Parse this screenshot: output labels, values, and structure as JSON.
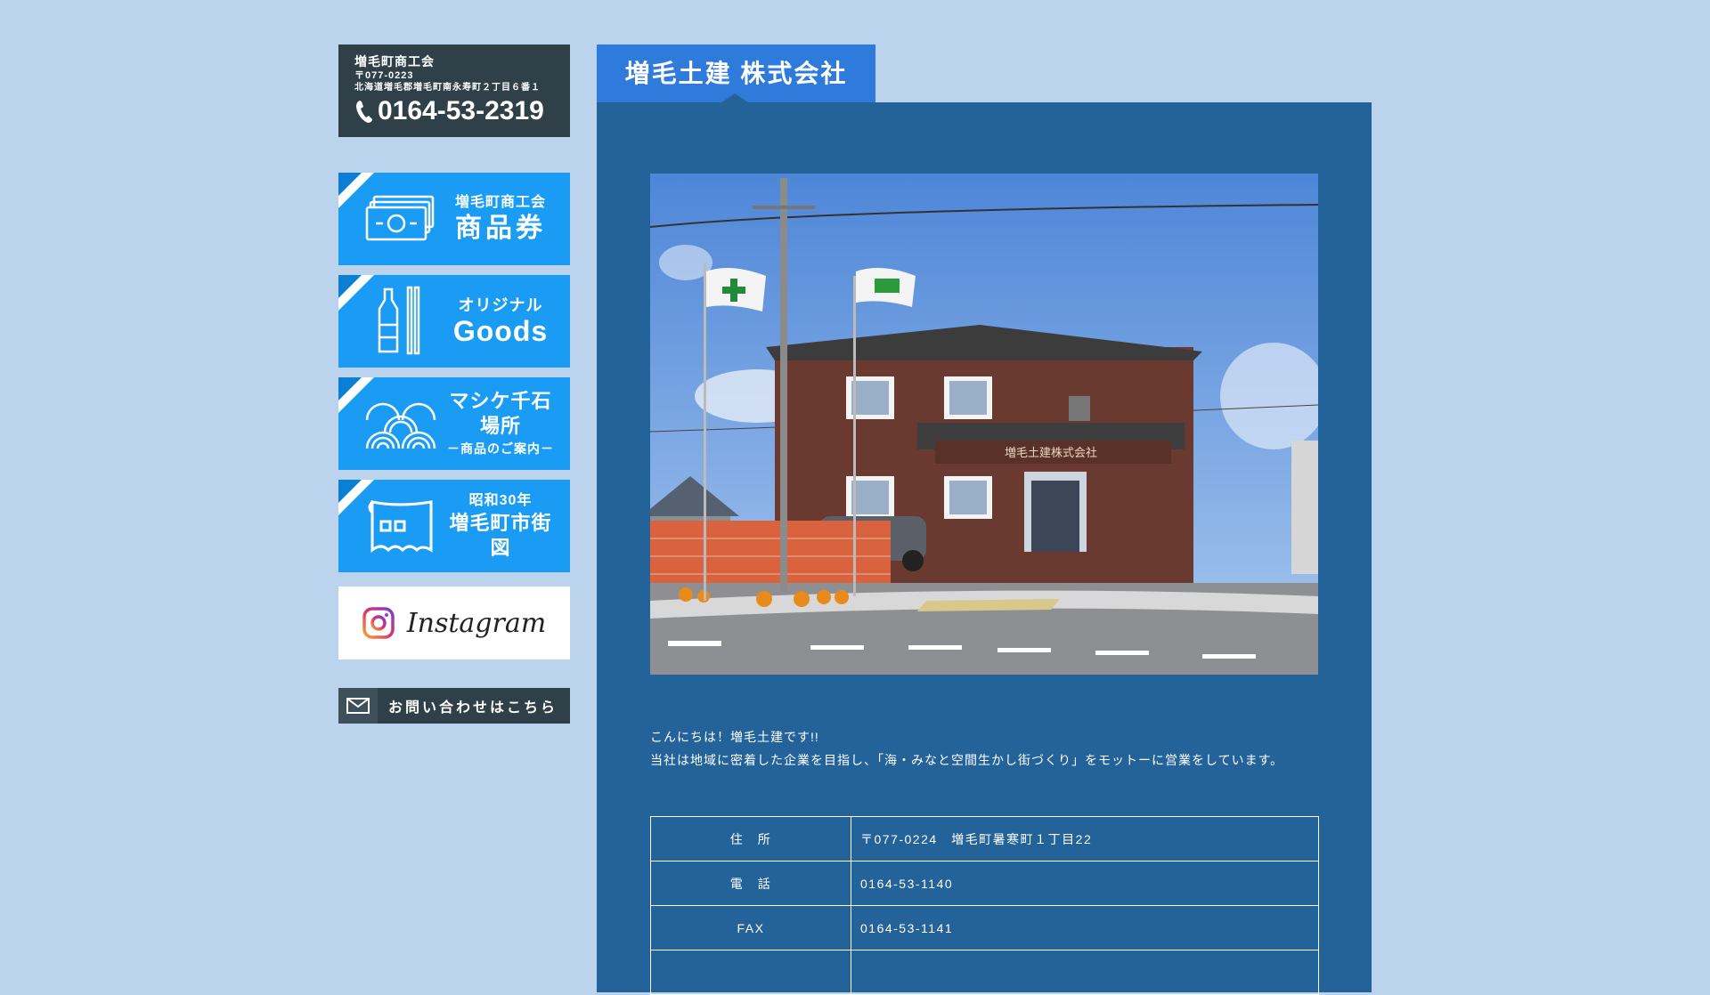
{
  "sidebar": {
    "org": {
      "name": "増毛町商工会",
      "zip": "〒077-0223",
      "address": "北海道増毛郡増毛町南永寿町２丁目６番１",
      "phone": "0164-53-2319",
      "phone_icon": "phone-icon"
    },
    "banners": [
      {
        "id": "voucher",
        "small": "増毛町商工会",
        "large": "商品券",
        "icon": "banknote-icon"
      },
      {
        "id": "goods",
        "small": "オリジナル",
        "large": "Goods",
        "icon": "bottle-icon"
      },
      {
        "id": "mashike",
        "title": "マシケ千石場所",
        "sub": "－商品のご案内－",
        "icon": "waves-icon"
      },
      {
        "id": "map",
        "small": "昭和30年",
        "title": "増毛町市街図",
        "icon": "map-icon"
      }
    ],
    "instagram": {
      "label": "Instagram",
      "icon": "instagram-icon"
    },
    "contact": {
      "label": "お問い合わせはこちら",
      "icon": "mail-icon"
    }
  },
  "main": {
    "title": "増毛土建 株式会社",
    "photo": {
      "sign_text": "増毛土建株式会社"
    },
    "intro": [
      "こんにちは！増毛土建です!!",
      "当社は地域に密着した企業を目指し、「海・みなと空間生かし街づくり」をモットーに営業をしています。"
    ],
    "info": [
      {
        "key": "住　所",
        "value": "〒077-0224　増毛町暑寒町１丁目22"
      },
      {
        "key": "電　話",
        "value": "0164-53-1140"
      },
      {
        "key": "FAX",
        "value": "0164-53-1141"
      },
      {
        "key": "",
        "value": ""
      }
    ]
  },
  "colors": {
    "background": "#bcd3ee",
    "panel": "#236399",
    "title": "#2e7bdc",
    "banner": "#1a9cf5",
    "dark": "#2f4048"
  }
}
